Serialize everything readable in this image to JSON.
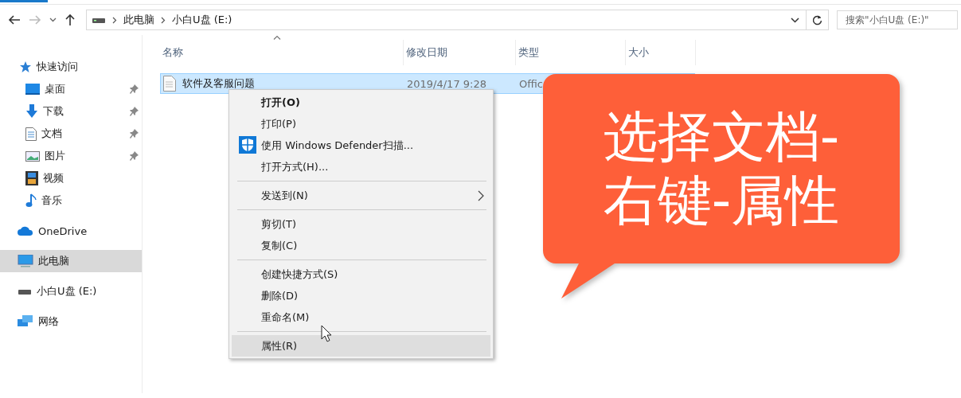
{
  "address_bar": {
    "crumbs": [
      "此电脑",
      "小白U盘 (E:)"
    ]
  },
  "search": {
    "placeholder": "搜索\"小白U盘 (E:)\""
  },
  "nav_buttons": [
    {
      "disabled": false
    },
    {
      "disabled": true
    },
    {
      "disabled": false
    },
    {
      "disabled": false
    }
  ],
  "sidebar": [
    {
      "label": "快速访问",
      "selected": false,
      "children": [
        {
          "label": "桌面",
          "pinned": true,
          "selected": false
        },
        {
          "label": "下载",
          "pinned": true,
          "selected": false
        },
        {
          "label": "文档",
          "pinned": true,
          "selected": false
        },
        {
          "label": "图片",
          "pinned": true,
          "selected": false
        },
        {
          "label": "视频",
          "pinned": false,
          "selected": false
        },
        {
          "label": "音乐",
          "pinned": false,
          "selected": false
        }
      ]
    },
    {
      "label": "OneDrive",
      "selected": false
    },
    {
      "label": "此电脑",
      "selected": true
    },
    {
      "label": "小白U盘 (E:)",
      "selected": false
    },
    {
      "label": "网络",
      "selected": false
    }
  ],
  "table": {
    "columns": [
      "名称",
      "修改日期",
      "类型",
      "大小"
    ],
    "rows": [
      {
        "name": "软件及客服问题",
        "date": "2019/4/17 9:28",
        "type": "Offic",
        "selected": true
      }
    ]
  },
  "context_menu": [
    {
      "kind": "item",
      "label": "打开(O)",
      "bold": true,
      "selected": false
    },
    {
      "kind": "item",
      "label": "打印(P)",
      "bold": false,
      "selected": false
    },
    {
      "kind": "item",
      "label": "使用 Windows Defender扫描...",
      "bold": false,
      "selected": false,
      "has_icon": true
    },
    {
      "kind": "item",
      "label": "打开方式(H)...",
      "bold": false,
      "selected": false
    },
    {
      "kind": "separator"
    },
    {
      "kind": "item",
      "label": "发送到(N)",
      "bold": false,
      "selected": false,
      "submenu": true
    },
    {
      "kind": "separator"
    },
    {
      "kind": "item",
      "label": "剪切(T)",
      "bold": false,
      "selected": false
    },
    {
      "kind": "item",
      "label": "复制(C)",
      "bold": false,
      "selected": false
    },
    {
      "kind": "separator"
    },
    {
      "kind": "item",
      "label": "创建快捷方式(S)",
      "bold": false,
      "selected": false
    },
    {
      "kind": "item",
      "label": "删除(D)",
      "bold": false,
      "selected": false
    },
    {
      "kind": "item",
      "label": "重命名(M)",
      "bold": false,
      "selected": false
    },
    {
      "kind": "separator"
    },
    {
      "kind": "item",
      "label": "属性(R)",
      "bold": false,
      "selected": true
    }
  ],
  "callout": {
    "lines": [
      "选择文档-",
      "右键-属性"
    ]
  }
}
